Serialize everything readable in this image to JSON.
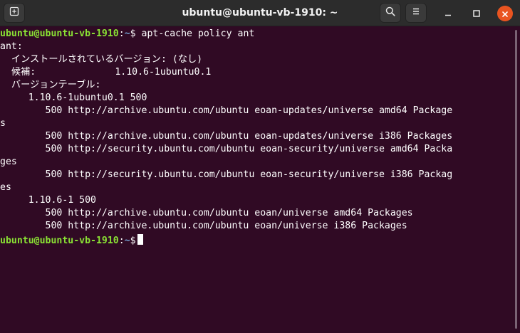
{
  "window": {
    "title": "ubuntu@ubuntu-vb-1910: ~"
  },
  "header": {
    "icons": [
      "new-tab-icon",
      "search-icon",
      "hamburger-menu-icon",
      "minimize-icon",
      "maximize-icon",
      "close-icon"
    ]
  },
  "colors": {
    "terminal_bg": "#300a24",
    "prompt_user": "#8ae234",
    "prompt_path": "#729fcf",
    "close_button": "#e95420"
  },
  "terminal": {
    "prompt_userhost": "ubuntu@ubuntu-vb-1910",
    "prompt_path": "~",
    "command": "apt-cache policy ant",
    "lines": [
      "ant:",
      "  インストールされているバージョン: (なし)",
      "  候補:              1.10.6-1ubuntu0.1",
      "  バージョンテーブル:",
      "     1.10.6-1ubuntu0.1 500",
      "        500 http://archive.ubuntu.com/ubuntu eoan-updates/universe amd64 Package",
      "s",
      "        500 http://archive.ubuntu.com/ubuntu eoan-updates/universe i386 Packages",
      "        500 http://security.ubuntu.com/ubuntu eoan-security/universe amd64 Packa",
      "ges",
      "        500 http://security.ubuntu.com/ubuntu eoan-security/universe i386 Packag",
      "es",
      "     1.10.6-1 500",
      "        500 http://archive.ubuntu.com/ubuntu eoan/universe amd64 Packages",
      "        500 http://archive.ubuntu.com/ubuntu eoan/universe i386 Packages"
    ]
  }
}
